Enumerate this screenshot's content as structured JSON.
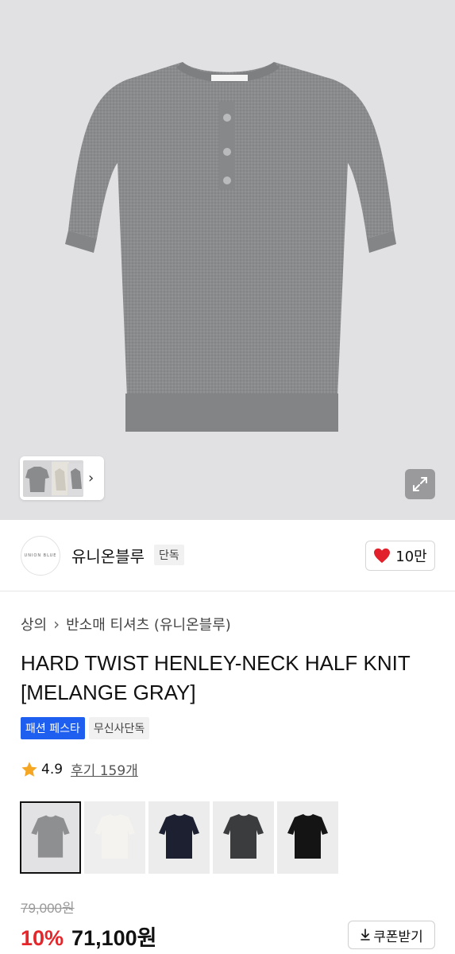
{
  "colors": {
    "hero_bg": "#e1e1e3",
    "knit": "#8a8b8d",
    "accent_blue": "#1e5ff0",
    "discount_red": "#e5262b",
    "heart_red": "#e1202b",
    "star": "#f5a623"
  },
  "gallery": {
    "thumbnail_icons": [
      "gray-shirt-icon",
      "beige-shirt-icon",
      "gray-shirt-icon"
    ],
    "next_icon": "chevron-right-icon",
    "expand_icon": "expand-icon"
  },
  "brand": {
    "logo_text": "UNION BLUE",
    "name": "유니온블루",
    "tag": "단독",
    "like_icon": "heart-icon",
    "like_count": "10만"
  },
  "breadcrumb": {
    "items": [
      "상의",
      "반소매 티셔츠 (유니온블루)"
    ],
    "separator_icon": "chevron-right-icon"
  },
  "product": {
    "title_line1": "HARD TWIST HENLEY-NECK HALF KNIT",
    "title_line2": "[MELANGE GRAY]",
    "badges": [
      "패션 페스타",
      "무신사단독"
    ],
    "rating_icon": "star-icon",
    "rating": "4.9",
    "reviews": "후기 159개"
  },
  "color_options": [
    {
      "name": "melange-gray",
      "hex": "#8e8f91",
      "selected": true
    },
    {
      "name": "ivory",
      "hex": "#e8e6e2",
      "selected": false
    },
    {
      "name": "navy",
      "hex": "#1c2030",
      "selected": false
    },
    {
      "name": "charcoal",
      "hex": "#3b3c3e",
      "selected": false
    },
    {
      "name": "black",
      "hex": "#141414",
      "selected": false
    }
  ],
  "price": {
    "original": "79,000원",
    "discount": "10%",
    "sale": "71,100원",
    "coupon_icon": "download-icon",
    "coupon_label": "쿠폰받기"
  }
}
